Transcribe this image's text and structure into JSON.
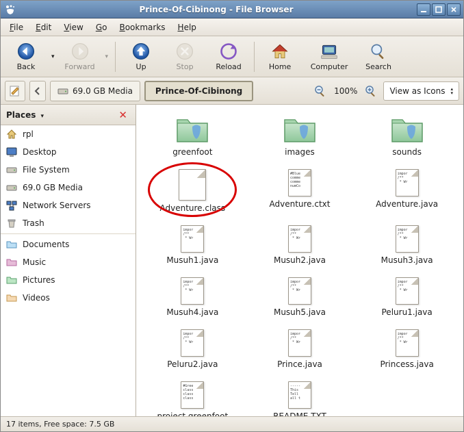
{
  "window": {
    "title": "Prince-Of-Cibinong - File Browser"
  },
  "menubar": [
    {
      "label": "File",
      "accel": "F"
    },
    {
      "label": "Edit",
      "accel": "E"
    },
    {
      "label": "View",
      "accel": "V"
    },
    {
      "label": "Go",
      "accel": "G"
    },
    {
      "label": "Bookmarks",
      "accel": "B"
    },
    {
      "label": "Help",
      "accel": "H"
    }
  ],
  "toolbar": {
    "back": "Back",
    "forward": "Forward",
    "up": "Up",
    "stop": "Stop",
    "reload": "Reload",
    "home": "Home",
    "computer": "Computer",
    "search": "Search"
  },
  "location": {
    "media_label": "69.0 GB Media",
    "current_label": "Prince-Of-Cibinong",
    "zoom_percent": "100%",
    "view_mode": "View as Icons"
  },
  "sidebar": {
    "title": "Places",
    "items_top": [
      {
        "id": "rpl",
        "label": "rpl",
        "icon": "home"
      },
      {
        "id": "desktop",
        "label": "Desktop",
        "icon": "desktop"
      },
      {
        "id": "filesystem",
        "label": "File System",
        "icon": "drive"
      },
      {
        "id": "media69",
        "label": "69.0 GB Media",
        "icon": "drive"
      },
      {
        "id": "network",
        "label": "Network Servers",
        "icon": "network"
      },
      {
        "id": "trash",
        "label": "Trash",
        "icon": "trash"
      }
    ],
    "items_bottom": [
      {
        "id": "documents",
        "label": "Documents",
        "icon": "folder-doc"
      },
      {
        "id": "music",
        "label": "Music",
        "icon": "folder-music"
      },
      {
        "id": "pictures",
        "label": "Pictures",
        "icon": "folder-pic"
      },
      {
        "id": "videos",
        "label": "Videos",
        "icon": "folder-vid"
      }
    ]
  },
  "files": [
    {
      "name": "greenfoot",
      "type": "folder"
    },
    {
      "name": "images",
      "type": "folder"
    },
    {
      "name": "sounds",
      "type": "folder"
    },
    {
      "name": "Adventure.class",
      "type": "class",
      "highlighted": true
    },
    {
      "name": "Adventure.ctxt",
      "type": "ctxt"
    },
    {
      "name": "Adventure.java",
      "type": "java"
    },
    {
      "name": "Musuh1.java",
      "type": "java"
    },
    {
      "name": "Musuh2.java",
      "type": "java"
    },
    {
      "name": "Musuh3.java",
      "type": "java"
    },
    {
      "name": "Musuh4.java",
      "type": "java"
    },
    {
      "name": "Musuh5.java",
      "type": "java"
    },
    {
      "name": "Peluru1.java",
      "type": "java"
    },
    {
      "name": "Peluru2.java",
      "type": "java"
    },
    {
      "name": "Prince.java",
      "type": "java"
    },
    {
      "name": "Princess.java",
      "type": "java"
    },
    {
      "name": "project.greenfoot",
      "type": "greenfoot"
    },
    {
      "name": "README.TXT",
      "type": "txt"
    }
  ],
  "statusbar": {
    "text": "17 items, Free space: 7.5 GB"
  },
  "doc_previews": {
    "java": "impor\n/**\n * Wr",
    "ctxt": "#Blue\ncomme\ncomme\nnumCo",
    "greenfoot": "#Gree\nclass\nclass\nclass",
    "txt": "-----\nThis\nTell\nall t"
  }
}
